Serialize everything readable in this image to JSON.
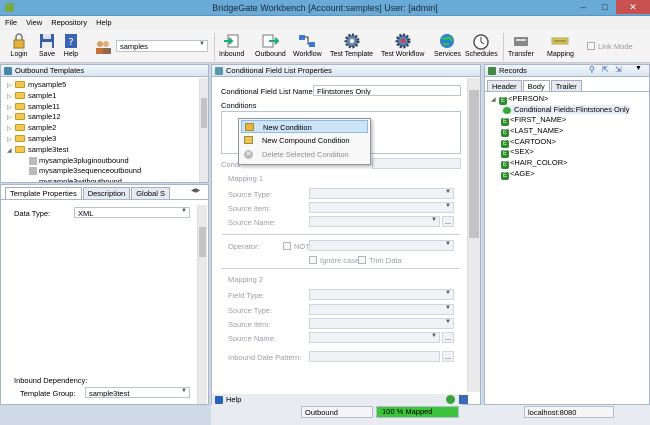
{
  "window": {
    "title": "BridgeGate Workbench [Account:samples] User: [admin]",
    "minimize": "–",
    "maximize": "□",
    "close": "✕"
  },
  "menu": [
    "File",
    "View",
    "Repository",
    "Help"
  ],
  "toolbar": {
    "login": "Login",
    "save": "Save",
    "help": "Help",
    "account_value": "samples",
    "inbound": "Inbound",
    "outbound": "Outbound",
    "workflow": "Workflow",
    "test_template": "Test Template",
    "test_workflow": "Test Workflow",
    "services": "Services",
    "schedules": "Schedules",
    "transfer": "Transfer",
    "mapping": "Mapping",
    "link_mode": "Link Mode"
  },
  "left": {
    "outbound_title": "Outbound Templates",
    "tree": [
      "mysample5",
      "sample1",
      "sample11",
      "sample12",
      "sample2",
      "sample3",
      "sample3test"
    ],
    "subtree": [
      "mysample3pluginoutbound",
      "mysample3sequenceoutbound",
      "mysample3withoutbound"
    ],
    "tabs": [
      "Template Properties",
      "Description",
      "Global S"
    ],
    "data_type_label": "Data Type:",
    "data_type_value": "XML",
    "inbound_dependency": "Inbound Dependency:",
    "template_group_label": "Template Group:",
    "template_group_value": "sample3test"
  },
  "center": {
    "title": "Conditional Field List Properties",
    "list_name_label": "Conditional Field List Name:",
    "list_name_value": "Flintstones Only",
    "conditions_label": "Conditions",
    "condition_hidden_label": "Condi",
    "mapping1": "Mapping 1",
    "source_type": "Source Type:",
    "source_item": "Source Item:",
    "source_name": "Source Name:",
    "operator": "Operator:",
    "not": "NOT",
    "ignore_case": "Ignore case",
    "trim_data": "Trim Data",
    "mapping2": "Mapping 2",
    "field_type": "Field Type:",
    "source_type2": "Source Type:",
    "source_item2": "Source Item:",
    "source_name2": "Source Name:",
    "inbound_date_pattern": "Inbound Date Pattern:",
    "ellipsis": "..."
  },
  "context_menu": [
    "New Condition",
    "New Compound Condition",
    "Delete Selected Condition"
  ],
  "right": {
    "title": "Records",
    "tabs": [
      "Header",
      "Body",
      "Trailer"
    ],
    "tree": [
      "<PERSON>",
      "Conditional Fields:Flintstones Only",
      "<FIRST_NAME>",
      "<LAST_NAME>",
      "<CARTOON>",
      "<SEX>",
      "<HAIR_COLOR>",
      "<AGE>"
    ]
  },
  "status": {
    "help": "Help",
    "mode": "Outbound",
    "progress": "100 %  Mapped",
    "progress_fraction": 1.0,
    "host": "localhost:8080"
  },
  "colors": {
    "titlebar": "#6aaad6",
    "panel_border": "#a7b7c9",
    "progress": "#3cc43c",
    "highlight": "#cde4f7"
  }
}
